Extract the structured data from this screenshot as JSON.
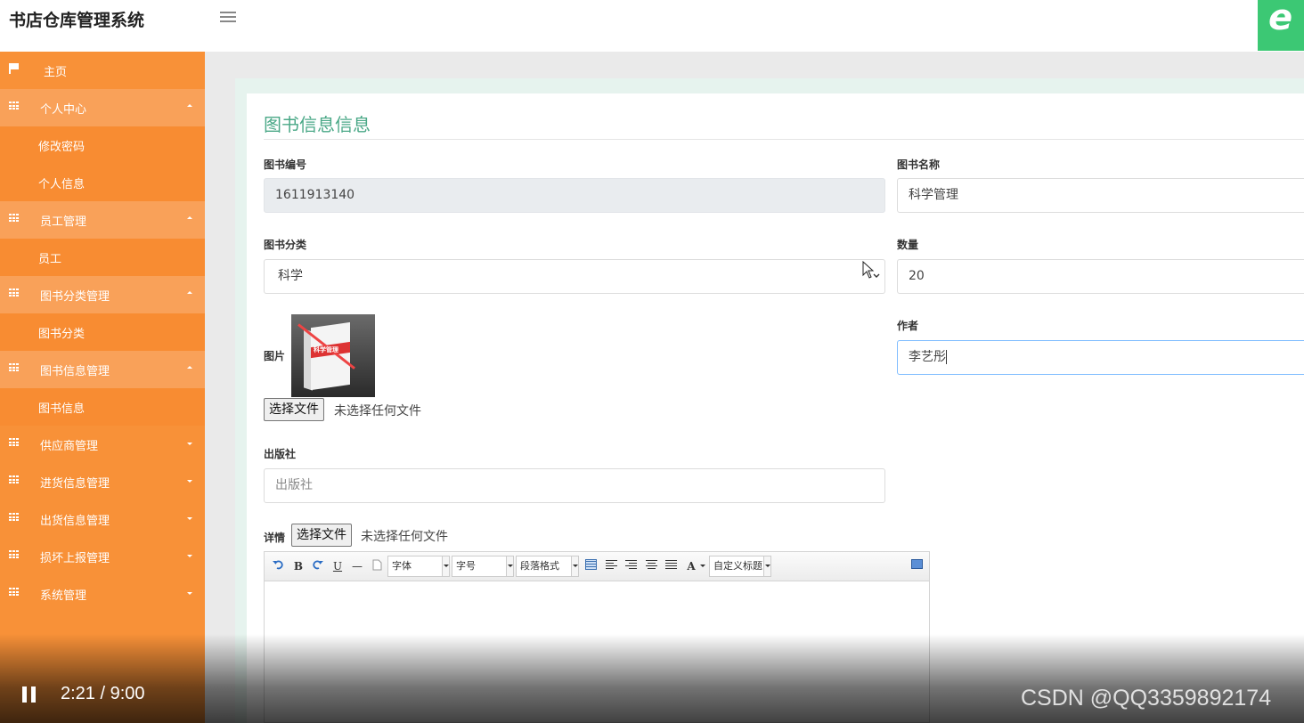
{
  "app": {
    "title": "书店仓库管理系统"
  },
  "sidebar": {
    "items": [
      {
        "label": "主页"
      },
      {
        "label": "个人中心"
      },
      {
        "label": "修改密码"
      },
      {
        "label": "个人信息"
      },
      {
        "label": "员工管理"
      },
      {
        "label": "员工"
      },
      {
        "label": "图书分类管理"
      },
      {
        "label": "图书分类"
      },
      {
        "label": "图书信息管理"
      },
      {
        "label": "图书信息"
      },
      {
        "label": "供应商管理"
      },
      {
        "label": "进货信息管理"
      },
      {
        "label": "出货信息管理"
      },
      {
        "label": "损坏上报管理"
      },
      {
        "label": "系统管理"
      }
    ]
  },
  "form": {
    "title": "图书信息信息",
    "book_no": {
      "label": "图书编号",
      "value": "1611913140"
    },
    "book_name": {
      "label": "图书名称",
      "value": "科学管理"
    },
    "category": {
      "label": "图书分类",
      "value": "科学"
    },
    "quantity": {
      "label": "数量",
      "value": "20"
    },
    "image": {
      "label": "图片",
      "cover_text": "科学管理",
      "choose_btn": "选择文件",
      "no_file": "未选择任何文件"
    },
    "author": {
      "label": "作者",
      "value": "李艺彤"
    },
    "publisher": {
      "label": "出版社",
      "placeholder": "出版社"
    },
    "details": {
      "label": "详情",
      "choose_btn": "选择文件",
      "no_file": "未选择任何文件"
    }
  },
  "editor": {
    "bold": "B",
    "underline": "U",
    "hr": "—",
    "font_family": "字体",
    "font_size": "字号",
    "paragraph": "段落格式",
    "font_color": "A",
    "custom_title": "自定义标题"
  },
  "video": {
    "time": "2:21 / 9:00"
  },
  "watermark": "CSDN @QQ3359892174",
  "colors": {
    "sidebar": "#f89138",
    "title_green": "#4aa887"
  }
}
